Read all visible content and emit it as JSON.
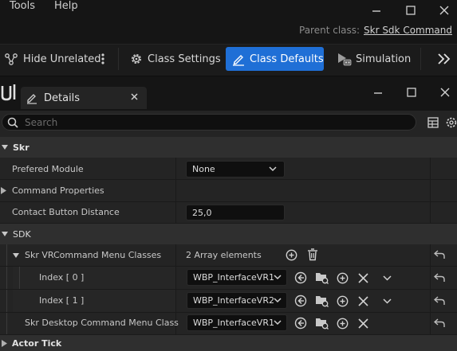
{
  "menu": {
    "tools": "Tools",
    "help": "Help"
  },
  "parent_class": {
    "label": "Parent class:",
    "value": "Skr Sdk Command"
  },
  "toolbar": {
    "hide_unrelated": "Hide Unrelated",
    "class_settings": "Class Settings",
    "class_defaults": "Class Defaults",
    "simulation": "Simulation"
  },
  "panel": {
    "tab_title": "Details",
    "search_placeholder": "Search"
  },
  "sections": {
    "skr": "Skr",
    "sdk": "SDK",
    "actor_tick": "Actor Tick"
  },
  "props": {
    "prefered_module": {
      "label": "Prefered Module",
      "value": "None"
    },
    "command_properties": {
      "label": "Command Properties"
    },
    "contact_button_distance": {
      "label": "Contact Button Distance",
      "value": "25,0"
    },
    "vr_menu_classes": {
      "label": "Skr VRCommand Menu Classes",
      "value": "2 Array elements"
    },
    "index0": {
      "label": "Index [ 0 ]",
      "value": "WBP_InterfaceVR1"
    },
    "index1": {
      "label": "Index [ 1 ]",
      "value": "WBP_InterfaceVR2"
    },
    "desktop_menu_class": {
      "label": "Skr Desktop Command Menu Class",
      "value": "WBP_InterfaceVR1"
    }
  },
  "colors": {
    "accent": "#1f6fd6",
    "background": "#151515",
    "panel": "#1e1e1e"
  }
}
